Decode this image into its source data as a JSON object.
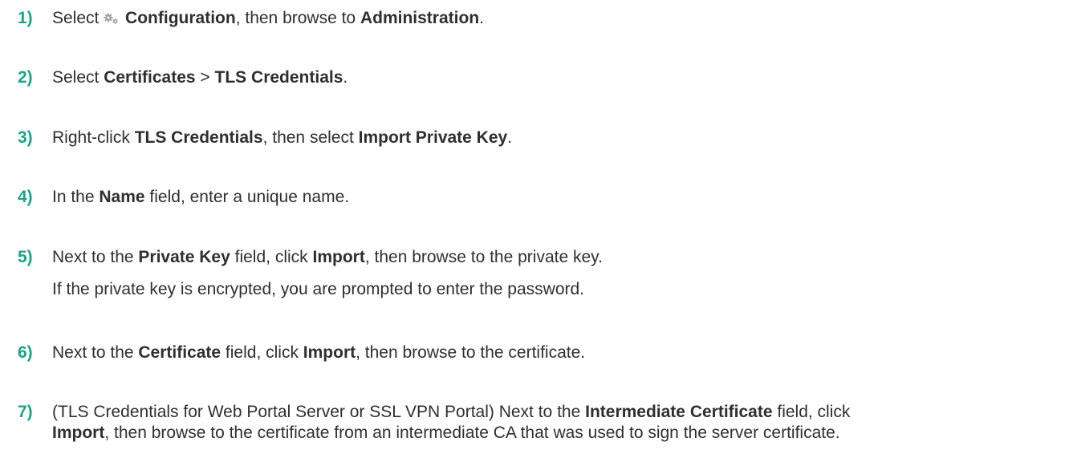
{
  "steps": [
    {
      "number": "1)",
      "parts": [
        {
          "text": "Select ",
          "bold": false
        },
        {
          "icon": "gear-icon"
        },
        {
          "text": "Configuration",
          "bold": true
        },
        {
          "text": ", then browse to ",
          "bold": false
        },
        {
          "text": "Administration",
          "bold": true
        },
        {
          "text": ".",
          "bold": false
        }
      ]
    },
    {
      "number": "2)",
      "parts": [
        {
          "text": "Select ",
          "bold": false
        },
        {
          "text": "Certificates",
          "bold": true
        },
        {
          "text": " > ",
          "bold": false
        },
        {
          "text": "TLS Credentials",
          "bold": true
        },
        {
          "text": ".",
          "bold": false
        }
      ]
    },
    {
      "number": "3)",
      "parts": [
        {
          "text": "Right-click ",
          "bold": false
        },
        {
          "text": "TLS Credentials",
          "bold": true
        },
        {
          "text": ", then select ",
          "bold": false
        },
        {
          "text": "Import Private Key",
          "bold": true
        },
        {
          "text": ".",
          "bold": false
        }
      ]
    },
    {
      "number": "4)",
      "parts": [
        {
          "text": "In the ",
          "bold": false
        },
        {
          "text": "Name",
          "bold": true
        },
        {
          "text": " field, enter a unique name.",
          "bold": false
        }
      ]
    },
    {
      "number": "5)",
      "parts": [
        {
          "text": "Next to the ",
          "bold": false
        },
        {
          "text": "Private Key",
          "bold": true
        },
        {
          "text": " field, click ",
          "bold": false
        },
        {
          "text": "Import",
          "bold": true
        },
        {
          "text": ", then browse to the private key.",
          "bold": false
        }
      ],
      "note": "If the private key is encrypted, you are prompted to enter the password."
    },
    {
      "number": "6)",
      "parts": [
        {
          "text": "Next to the ",
          "bold": false
        },
        {
          "text": "Certificate",
          "bold": true
        },
        {
          "text": " field, click ",
          "bold": false
        },
        {
          "text": "Import",
          "bold": true
        },
        {
          "text": ", then browse to the certificate.",
          "bold": false
        }
      ]
    },
    {
      "number": "7)",
      "parts": [
        {
          "text": "(TLS Credentials for Web Portal Server or SSL VPN Portal) Next to the ",
          "bold": false
        },
        {
          "text": "Intermediate Certificate",
          "bold": true
        },
        {
          "text": " field, click",
          "bold": false
        }
      ],
      "continuation": [
        {
          "text": "Import",
          "bold": true
        },
        {
          "text": ", then browse to the certificate from an intermediate CA that was used to sign the server certificate.",
          "bold": false
        }
      ]
    }
  ],
  "colors": {
    "number": "#1aa58a",
    "text": "#2f2f2f",
    "icon": "#a0a0a0"
  }
}
